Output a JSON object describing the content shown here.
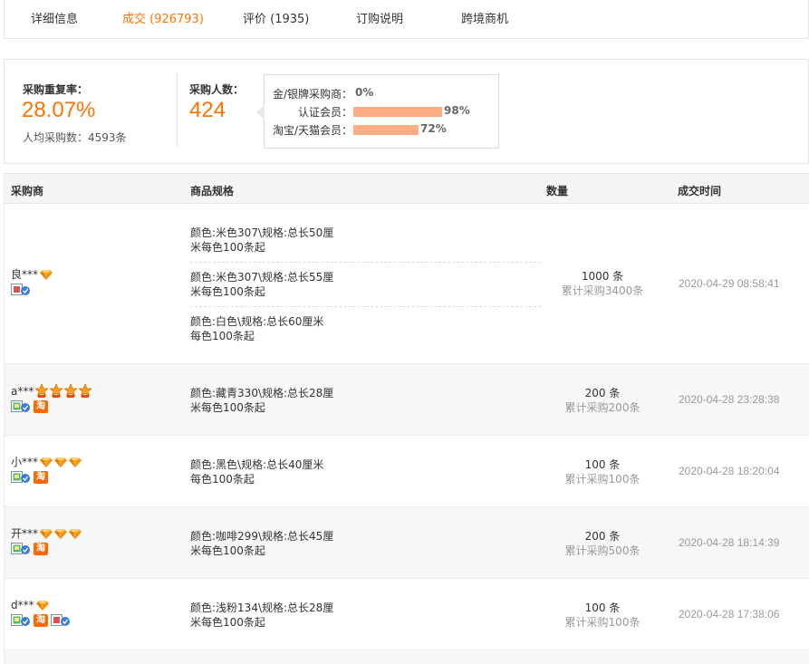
{
  "tabs": [
    {
      "label": "详细信息"
    },
    {
      "label": "成交 (926793)",
      "active": true
    },
    {
      "label": "评价 (1935)"
    },
    {
      "label": "订购说明"
    },
    {
      "label": "跨境商机"
    }
  ],
  "summary": {
    "repeat_label": "采购重复率：",
    "repeat_value": "28.07%",
    "avg_label": "人均采购数：4593条",
    "buyers_label": "采购人数：",
    "buyers_value": "424",
    "members": [
      {
        "label": "金/银牌采购商：",
        "value": "0%",
        "fraction": 0.0
      },
      {
        "label": "认证会员：",
        "value": "98%",
        "fraction": 0.98
      },
      {
        "label": "淘宝/天猫会员：",
        "value": "72%",
        "fraction": 0.72
      }
    ]
  },
  "table": {
    "headers": {
      "buyer": "采购商",
      "spec": "商品规格",
      "qty": "数量",
      "time": "成交时间"
    },
    "rows": [
      {
        "buyer": "良***",
        "specs": [
          [
            "颜色:米色307\\规格:总长50厘",
            "米每色100条起"
          ],
          [
            "颜色:米色307\\规格:总长55厘",
            "米每色100条起"
          ],
          [
            "颜色:白色\\规格:总长60厘米",
            "每色100条起"
          ]
        ],
        "qty": "1000 条",
        "total": "累计采购3400条",
        "time": "2020-04-29 08:58:41"
      },
      {
        "buyer": "a***",
        "specs": [
          [
            "颜色:藏青330\\规格:总长28厘",
            "米每色100条起"
          ]
        ],
        "qty": "200 条",
        "total": "累计采购200条",
        "time": "2020-04-28 23:28:38"
      },
      {
        "buyer": "小***",
        "specs": [
          [
            "颜色:黑色\\规格:总长40厘米",
            "每色100条起"
          ]
        ],
        "qty": "100 条",
        "total": "累计采购100条",
        "time": "2020-04-28 18:20:04"
      },
      {
        "buyer": "开***",
        "specs": [
          [
            "颜色:咖啡299\\规格:总长45厘",
            "米每色100条起"
          ]
        ],
        "qty": "200 条",
        "total": "累计采购500条",
        "time": "2020-04-28 18:14:39"
      },
      {
        "buyer": "d***",
        "specs": [
          [
            "颜色:浅粉134\\规格:总长28厘",
            "米每色100条起"
          ]
        ],
        "qty": "100 条",
        "total": "累计采购100条",
        "time": "2020-04-28 17:38:06"
      }
    ]
  },
  "icons": {
    "gem": "diamond-icon",
    "crown": "crown-icon",
    "verified": "verified-member-icon",
    "tao": "淘"
  },
  "colors": {
    "accent": "#ff7300",
    "bar": "#fdad84",
    "gem": "#f59b23"
  }
}
